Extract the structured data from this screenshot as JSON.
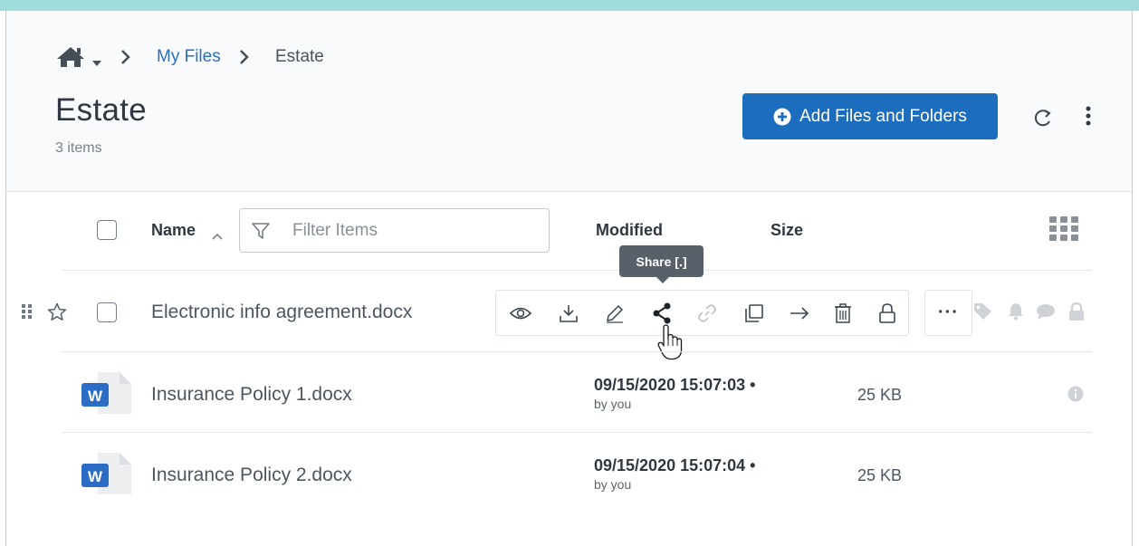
{
  "breadcrumb": {
    "home_icon": "home-icon",
    "home_menu_icon": "caret-down-icon",
    "separator": ">",
    "items": [
      "My Files",
      "Estate"
    ]
  },
  "header": {
    "title": "Estate",
    "count": "3 items",
    "add_button": "Add Files and Folders",
    "refresh_icon": "refresh-icon",
    "more_icon": "kebab-icon"
  },
  "columns": {
    "name": "Name",
    "filter_placeholder": "Filter Items",
    "modified": "Modified",
    "size": "Size",
    "view_icon": "grid-view-icon"
  },
  "tooltip": "Share [.]",
  "hover_row": {
    "name": "Electronic info agreement.docx",
    "actions": [
      "preview-icon",
      "download-icon",
      "edit-icon",
      "share-icon",
      "link-icon",
      "copy-icon",
      "move-icon",
      "delete-icon",
      "lock-icon"
    ],
    "more_label": "···",
    "status_icons": [
      "tag-icon",
      "bell-icon",
      "comment-icon",
      "lock-icon"
    ]
  },
  "rows": [
    {
      "name": "Insurance Policy 1.docx",
      "modified": "09/15/2020 15:07:03 •",
      "by": "by you",
      "size": "25 KB"
    },
    {
      "name": "Insurance Policy 2.docx",
      "modified": "09/15/2020 15:07:04 •",
      "by": "by you",
      "size": "25 KB"
    }
  ],
  "colors": {
    "accent": "#1c6dbd",
    "link": "#2b6fc0",
    "top_bar": "#9fdcdb",
    "word_blue": "#2b6cc4",
    "tooltip_bg": "#58606a"
  }
}
